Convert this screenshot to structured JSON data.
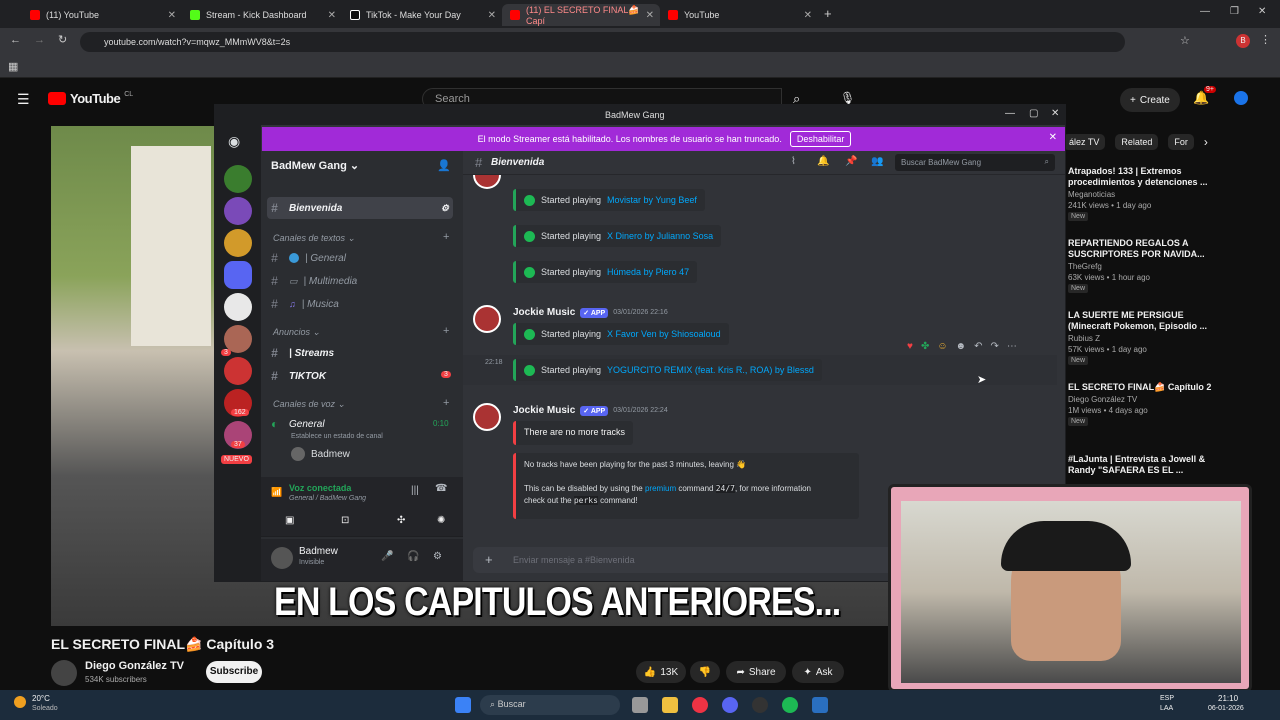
{
  "browser": {
    "tabs": [
      {
        "label": "(11) YouTube",
        "color": "#ff0000"
      },
      {
        "label": "Stream - Kick Dashboard",
        "color": "#53fc18"
      },
      {
        "label": "TikTok - Make Your Day",
        "color": "#ffffff"
      },
      {
        "label": "(11) EL SECRETO FINAL🍰 Capí",
        "color": "#ff0000"
      },
      {
        "label": "YouTube",
        "color": "#ff0000"
      }
    ],
    "url": "youtube.com/watch?v=mqwz_MMmWV8&t=2s"
  },
  "youtube": {
    "logo": "YouTube",
    "logo_region": "CL",
    "search_placeholder": "Search",
    "create_label": "Create",
    "notif_badge": "9+",
    "tabs": [
      "ález TV",
      "Related",
      "For"
    ],
    "video_title": "EL SECRETO FINAL🍰 Capítulo 3",
    "channel_name": "Diego González TV",
    "subscribers": "534K subscribers",
    "subscribe_label": "Subscribe",
    "likes": "13K",
    "share_label": "Share",
    "ask_label": "Ask",
    "caption": "EN LOS CAPITULOS ANTERIORES...",
    "recommended": [
      {
        "title": "Atrapados! 133 | Extremos procedimientos y detenciones ...",
        "channel": "Meganoticias",
        "meta": "241K views • 1 day ago",
        "badge": "New"
      },
      {
        "title": "REPARTIENDO REGALOS A SUSCRIPTORES POR NAVIDA...",
        "channel": "TheGrefg",
        "meta": "63K views • 1 hour ago",
        "badge": "New"
      },
      {
        "title": "LA SUERTE ME PERSIGUE (Minecraft Pokemon, Episodio ...",
        "channel": "Rubius Z",
        "meta": "57K views • 1 day ago",
        "badge": "New"
      },
      {
        "title": "EL SECRETO FINAL🍰 Capítulo 2",
        "channel": "Diego González TV",
        "meta": "1M views • 4 days ago",
        "badge": "New"
      },
      {
        "title": "#LaJunta | Entrevista a Jowell & Randy \"SAFAERA ES EL ...",
        "channel": "",
        "meta": "",
        "badge": ""
      }
    ]
  },
  "discord": {
    "window_title": "BadMew Gang",
    "banner_text": "El modo Streamer está habilitado. Los nombres de usuario se han truncado.",
    "banner_button": "Deshabilitar",
    "server_name": "BadMew Gang",
    "current_channel": "Bienvenida",
    "search_placeholder": "Buscar BadMew Gang",
    "nuevo_badge": "NUEVO",
    "guild_badges": [
      "3",
      "162",
      "37"
    ],
    "categories": {
      "text": "Canales de textos",
      "announce": "Anuncios",
      "voice": "Canales de voz"
    },
    "channels": {
      "bienvenida": "Bienvenida",
      "general": "| General",
      "multimedia": "| Multimedia",
      "musica": "| Musica",
      "streams": "| Streams",
      "tiktok": "TIKTOK",
      "tiktok_badge": "3",
      "voice_general": "General",
      "voice_time": "0:10",
      "voice_status": "Establece un estado de canal",
      "voice_user": "Badmew"
    },
    "voice_panel": {
      "status": "Voz conectada",
      "location": "General / BadMew Gang"
    },
    "user": {
      "name": "Badmew",
      "status": "Invisible"
    },
    "messages": {
      "plays1": [
        {
          "prefix": "Started playing",
          "track": "Movistar by Yung Beef"
        },
        {
          "prefix": "Started playing",
          "track": "X Dinero by Julianno Sosa"
        },
        {
          "prefix": "Started playing",
          "track": "Húmeda by Piero 47"
        }
      ],
      "author": "Jockie Music",
      "app_badge": "✓ APP",
      "ts1": "03/01/2026 22:16",
      "plays2": [
        {
          "prefix": "Started playing",
          "track": "X Favor Ven by Shiosoaloud"
        },
        {
          "prefix": "Started playing",
          "track": "YOGURCITO REMIX (feat. Kris R., ROA) by Blessd"
        }
      ],
      "side_time": "22:18",
      "ts2": "03/01/2026 22:24",
      "no_tracks": "There are no more tracks",
      "leaving": "No tracks have been playing for the past 3 minutes, leaving 👋",
      "disable_a": "This can be disabled by using the",
      "premium": "premium",
      "disable_b": "command",
      "cmd": "24/7",
      "disable_c": ", for more information",
      "check_a": "check out the",
      "perks": "perks",
      "check_b": "command!"
    },
    "input_placeholder": "Enviar mensaje a #Bienvenida"
  },
  "taskbar": {
    "weather_temp": "20°C",
    "weather_desc": "Soleado",
    "search": "Buscar",
    "lang": "ESP",
    "lang2": "LAA",
    "time": "21:10",
    "date": "06-01-2026"
  }
}
